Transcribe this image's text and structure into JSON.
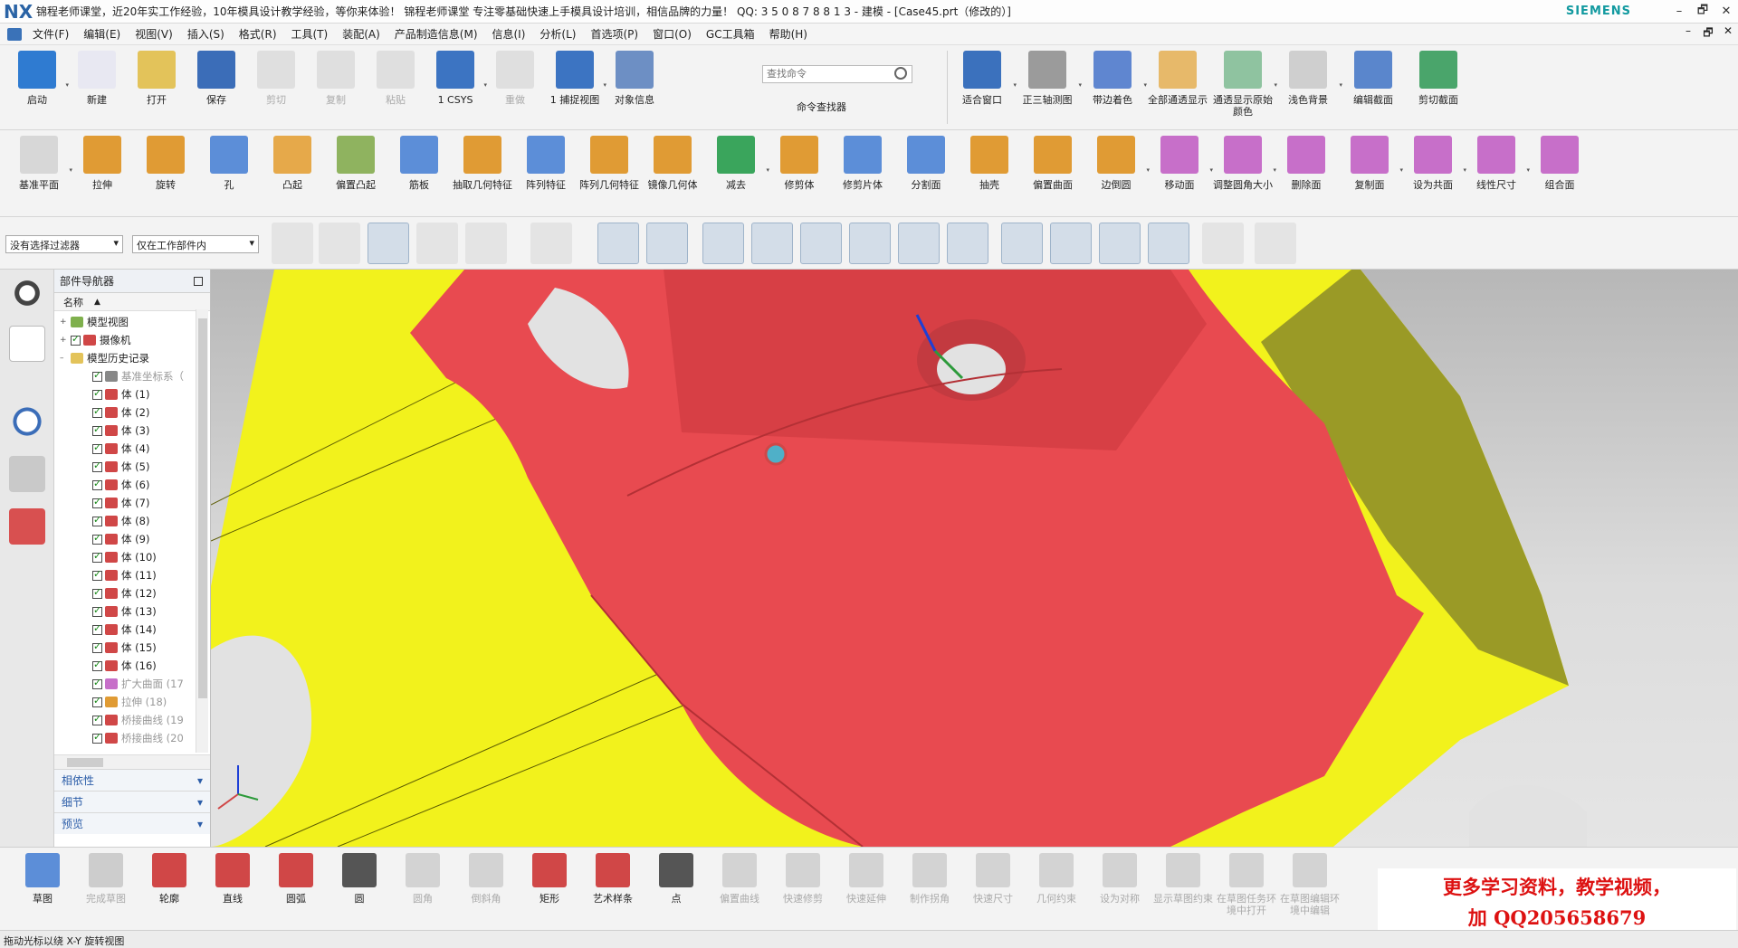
{
  "window": {
    "app_logo": "NX",
    "title": "锦程老师课堂，近20年实工作经验，10年模具设计教学经验，等你来体验！        锦程老师课堂        专注零基础快速上手模具设计培训，相信品牌的力量！  QQ: 3 5 0 8 7 8 8 1 3 - 建模 - [Case45.prt（修改的）]",
    "brand": "SIEMENS",
    "min": "–",
    "max": "🗗",
    "close": "✕"
  },
  "menu": [
    "文件(F)",
    "编辑(E)",
    "视图(V)",
    "插入(S)",
    "格式(R)",
    "工具(T)",
    "装配(A)",
    "产品制造信息(M)",
    "信息(I)",
    "分析(L)",
    "首选项(P)",
    "窗口(O)",
    "GC工具箱",
    "帮助(H)"
  ],
  "mdi": [
    "–",
    "🗗",
    "✕"
  ],
  "ribbon1": [
    {
      "label": "启动",
      "color": "#2f7bd1",
      "disabled": false,
      "dropdown": true
    },
    {
      "label": "新建",
      "color": "#e8e8f2",
      "disabled": false
    },
    {
      "label": "打开",
      "color": "#e3c35a",
      "disabled": false
    },
    {
      "label": "保存",
      "color": "#3b6db8",
      "disabled": false
    },
    {
      "label": "剪切",
      "color": "#bbbbbb",
      "disabled": true
    },
    {
      "label": "复制",
      "color": "#bbbbbb",
      "disabled": true
    },
    {
      "label": "粘贴",
      "color": "#bbbbbb",
      "disabled": true
    },
    {
      "label": "1 CSYS",
      "color": "#3c74c2",
      "disabled": false,
      "dropdown": true
    },
    {
      "label": "重做",
      "color": "#bbbbbb",
      "disabled": true
    },
    {
      "label": "1 捕捉视图",
      "color": "#3c74c2",
      "disabled": false,
      "dropdown": true
    },
    {
      "label": "对象信息",
      "color": "#6d8fc4",
      "disabled": false
    }
  ],
  "find": {
    "placeholder": "查找命令",
    "label": "命令查找器"
  },
  "ribbon1b": [
    {
      "label": "适合窗口",
      "color": "#3b71bd",
      "dropdown": true
    },
    {
      "label": "正三轴测图",
      "color": "#9b9b9b",
      "dropdown": true
    },
    {
      "label": "带边着色",
      "color": "#5f86d0",
      "dropdown": true
    },
    {
      "label": "全部通透显示",
      "color": "#e7b96a",
      "dropdown": false
    },
    {
      "label": "通透显示原始颜色",
      "color": "#8fc3a0",
      "dropdown": true
    },
    {
      "label": "浅色背景",
      "color": "#cfcfcf",
      "dropdown": true
    },
    {
      "label": "编辑截面",
      "color": "#5a86cc",
      "dropdown": false
    },
    {
      "label": "剪切截面",
      "color": "#4aa56b",
      "dropdown": false
    }
  ],
  "ribbon2": [
    {
      "label": "基准平面",
      "color": "#d7d7d7",
      "dropdown": true
    },
    {
      "label": "拉伸",
      "color": "#e09b34"
    },
    {
      "label": "旋转",
      "color": "#e09b34"
    },
    {
      "label": "孔",
      "color": "#5c8ed8"
    },
    {
      "label": "凸起",
      "color": "#e6a94a"
    },
    {
      "label": "偏置凸起",
      "color": "#8fb35f"
    },
    {
      "label": "筋板",
      "color": "#5c8ed8"
    },
    {
      "label": "抽取几何特征",
      "color": "#e09b34"
    },
    {
      "label": "阵列特征",
      "color": "#5c8ed8"
    },
    {
      "label": "阵列几何特征",
      "color": "#e09b34"
    },
    {
      "label": "镜像几何体",
      "color": "#e09b34"
    },
    {
      "label": "减去",
      "color": "#3aa55c",
      "dropdown": true
    },
    {
      "label": "修剪体",
      "color": "#e09b34"
    },
    {
      "label": "修剪片体",
      "color": "#5c8ed8"
    },
    {
      "label": "分割面",
      "color": "#5c8ed8"
    },
    {
      "label": "抽壳",
      "color": "#e09b34"
    },
    {
      "label": "偏置曲面",
      "color": "#e09b34"
    },
    {
      "label": "边倒圆",
      "color": "#e09b34",
      "dropdown": true
    },
    {
      "label": "移动面",
      "color": "#c76fc9",
      "dropdown": true
    },
    {
      "label": "调整圆角大小",
      "color": "#c76fc9",
      "dropdown": true
    },
    {
      "label": "删除面",
      "color": "#c76fc9"
    },
    {
      "label": "复制面",
      "color": "#c76fc9",
      "dropdown": true
    },
    {
      "label": "设为共面",
      "color": "#c76fc9",
      "dropdown": true
    },
    {
      "label": "线性尺寸",
      "color": "#c76fc9",
      "dropdown": true
    },
    {
      "label": "组合面",
      "color": "#c76fc9"
    }
  ],
  "selection": {
    "filter": "没有选择过滤器",
    "scope": "仅在工作部件内"
  },
  "navigator": {
    "title": "部件导航器",
    "column": "名称",
    "items": [
      {
        "label": "模型视图",
        "indent": 0,
        "check": false,
        "color": "#7fb04d",
        "exp": "+"
      },
      {
        "label": "摄像机",
        "indent": 0,
        "check": true,
        "color": "#d04747",
        "exp": "+"
      },
      {
        "label": "模型历史记录",
        "indent": 0,
        "check": false,
        "color": "#e3c35a",
        "exp": "–"
      },
      {
        "label": "基准坐标系（",
        "indent": 1,
        "check": true,
        "color": "#888888",
        "grey": true
      },
      {
        "label": "体 (1)",
        "indent": 1,
        "check": true,
        "color": "#d04747"
      },
      {
        "label": "体 (2)",
        "indent": 1,
        "check": true,
        "color": "#d04747"
      },
      {
        "label": "体 (3)",
        "indent": 1,
        "check": true,
        "color": "#d04747"
      },
      {
        "label": "体 (4)",
        "indent": 1,
        "check": true,
        "color": "#d04747"
      },
      {
        "label": "体 (5)",
        "indent": 1,
        "check": true,
        "color": "#d04747"
      },
      {
        "label": "体 (6)",
        "indent": 1,
        "check": true,
        "color": "#d04747"
      },
      {
        "label": "体 (7)",
        "indent": 1,
        "check": true,
        "color": "#d04747"
      },
      {
        "label": "体 (8)",
        "indent": 1,
        "check": true,
        "color": "#d04747"
      },
      {
        "label": "体 (9)",
        "indent": 1,
        "check": true,
        "color": "#d04747"
      },
      {
        "label": "体 (10)",
        "indent": 1,
        "check": true,
        "color": "#d04747"
      },
      {
        "label": "体 (11)",
        "indent": 1,
        "check": true,
        "color": "#d04747"
      },
      {
        "label": "体 (12)",
        "indent": 1,
        "check": true,
        "color": "#d04747"
      },
      {
        "label": "体 (13)",
        "indent": 1,
        "check": true,
        "color": "#d04747"
      },
      {
        "label": "体 (14)",
        "indent": 1,
        "check": true,
        "color": "#d04747"
      },
      {
        "label": "体 (15)",
        "indent": 1,
        "check": true,
        "color": "#d04747"
      },
      {
        "label": "体 (16)",
        "indent": 1,
        "check": true,
        "color": "#d04747"
      },
      {
        "label": "扩大曲面 (17",
        "indent": 1,
        "check": true,
        "color": "#c76fc9",
        "grey": true
      },
      {
        "label": "拉伸 (18)",
        "indent": 1,
        "check": true,
        "color": "#e09b34",
        "grey": true
      },
      {
        "label": "桥接曲线 (19",
        "indent": 1,
        "check": true,
        "color": "#d04747",
        "grey": true
      },
      {
        "label": "桥接曲线 (20",
        "indent": 1,
        "check": true,
        "color": "#d04747",
        "grey": true
      }
    ],
    "accordions": [
      "相依性",
      "细节",
      "预览"
    ]
  },
  "bottom": [
    {
      "label": "草图",
      "color": "#5c8ed8",
      "dis": false
    },
    {
      "label": "完成草图",
      "color": "#888888",
      "dis": true
    },
    {
      "label": "轮廓",
      "color": "#d04747",
      "dis": false
    },
    {
      "label": "直线",
      "color": "#d04747",
      "dis": false
    },
    {
      "label": "圆弧",
      "color": "#d04747",
      "dis": false
    },
    {
      "label": "圆",
      "color": "#555555",
      "dis": false
    },
    {
      "label": "圆角",
      "color": "#999999",
      "dis": true
    },
    {
      "label": "倒斜角",
      "color": "#999999",
      "dis": true
    },
    {
      "label": "矩形",
      "color": "#d04747",
      "dis": false
    },
    {
      "label": "艺术样条",
      "color": "#d04747",
      "dis": false
    },
    {
      "label": "点",
      "color": "#555555",
      "dis": false
    },
    {
      "label": "偏置曲线",
      "color": "#999999",
      "dis": true
    },
    {
      "label": "快速修剪",
      "color": "#999999",
      "dis": true
    },
    {
      "label": "快速延伸",
      "color": "#999999",
      "dis": true
    },
    {
      "label": "制作拐角",
      "color": "#999999",
      "dis": true
    },
    {
      "label": "快速尺寸",
      "color": "#999999",
      "dis": true
    },
    {
      "label": "几何约束",
      "color": "#999999",
      "dis": true
    },
    {
      "label": "设为对称",
      "color": "#999999",
      "dis": true
    },
    {
      "label": "显示草图约束",
      "color": "#999999",
      "dis": true
    },
    {
      "label": "在草图任务环境中打开",
      "color": "#999999",
      "dis": true
    },
    {
      "label": "在草图编辑环境中编辑",
      "color": "#999999",
      "dis": true
    }
  ],
  "promo": {
    "line1": "更多学习资料，教学视频，",
    "line2": "加 QQ205658679"
  },
  "status": "拖动光标以绕 X-Y 旋转视图",
  "colors": {
    "part": "#e84a50",
    "plate": "#f2f21c",
    "accent": "#2a63a5"
  }
}
